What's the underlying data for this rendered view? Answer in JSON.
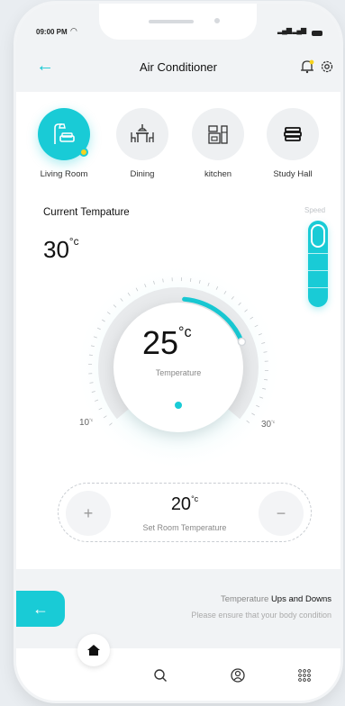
{
  "status_bar": {
    "time": "09:00 PM",
    "wifi_icon": "wifi-icon",
    "signal_icon": "signal-icon",
    "battery_icon": "battery-icon"
  },
  "header": {
    "title": "Air Conditioner",
    "back_icon": "arrow-left-icon",
    "notification_icon": "bell-icon",
    "settings_icon": "gear-icon"
  },
  "rooms": [
    {
      "label": "Living Room",
      "icon": "lamp-sofa-icon",
      "active": true
    },
    {
      "label": "Dining",
      "icon": "dining-table-icon",
      "active": false
    },
    {
      "label": "kitchen",
      "icon": "kitchen-icon",
      "active": false
    },
    {
      "label": "Study Hall",
      "icon": "books-icon",
      "active": false
    }
  ],
  "current": {
    "label": "Current Tempature",
    "value": "30",
    "unit": "°c"
  },
  "speed": {
    "label": "Speed",
    "level": 0.2
  },
  "dial": {
    "value": "25",
    "unit": "°c",
    "caption": "Temperature",
    "min_label": "10",
    "max_label": "30",
    "min_unit": "°c",
    "max_unit": "°c"
  },
  "set_temp": {
    "value": "20",
    "unit": "°c",
    "caption": "Set Room Temperature",
    "plus": "+",
    "minus": "−"
  },
  "info": {
    "line1_prefix": "Temperature ",
    "line1_bold": "Ups and Downs",
    "line2": "Please ensure that your body condition"
  },
  "toggle_icon": "arrow-left-icon",
  "nav": {
    "items": [
      "home-icon",
      "search-icon",
      "profile-icon",
      "grid-icon"
    ]
  },
  "colors": {
    "accent": "#19cbd6",
    "dot": "#f7d31e"
  }
}
